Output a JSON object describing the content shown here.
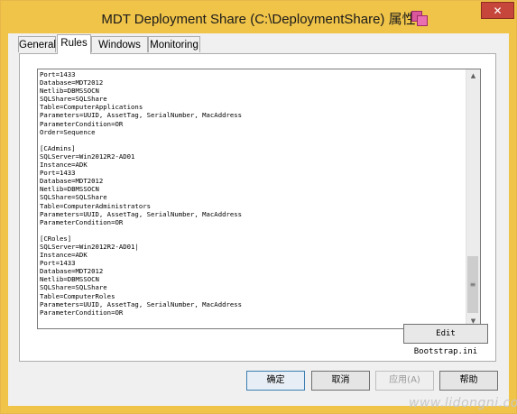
{
  "window": {
    "title": "MDT Deployment Share (C:\\DeploymentShare) 属性",
    "close_label": "✕"
  },
  "tabs": [
    {
      "label": "General"
    },
    {
      "label": "Rules"
    },
    {
      "label": "Windows PE"
    },
    {
      "label": "Monitoring"
    }
  ],
  "active_tab": "Rules",
  "rules_text": "Port=1433\nDatabase=MDT2012\nNetlib=DBMSSOCN\nSQLShare=SQLShare\nTable=ComputerApplications\nParameters=UUID, AssetTag, SerialNumber, MacAddress\nParameterCondition=OR\nOrder=Sequence\n\n[CAdmins]\nSQLServer=Win2012R2-AD01\nInstance=ADK\nPort=1433\nDatabase=MDT2012\nNetlib=DBMSSOCN\nSQLShare=SQLShare\nTable=ComputerAdministrators\nParameters=UUID, AssetTag, SerialNumber, MacAddress\nParameterCondition=OR\n\n[CRoles]\nSQLServer=Win2012R2-AD01|\nInstance=ADK\nPort=1433\nDatabase=MDT2012\nNetlib=DBMSSOCN\nSQLShare=SQLShare\nTable=ComputerRoles\nParameters=UUID, AssetTag, SerialNumber, MacAddress\nParameterCondition=OR",
  "scrollbar": {
    "position": 0.82
  },
  "edit_bootstrap_label": "Edit Bootstrap.ini",
  "buttons": {
    "ok": "确定",
    "cancel": "取消",
    "apply": "应用(A)",
    "help": "帮助"
  },
  "watermark": "www.lidongni.com"
}
